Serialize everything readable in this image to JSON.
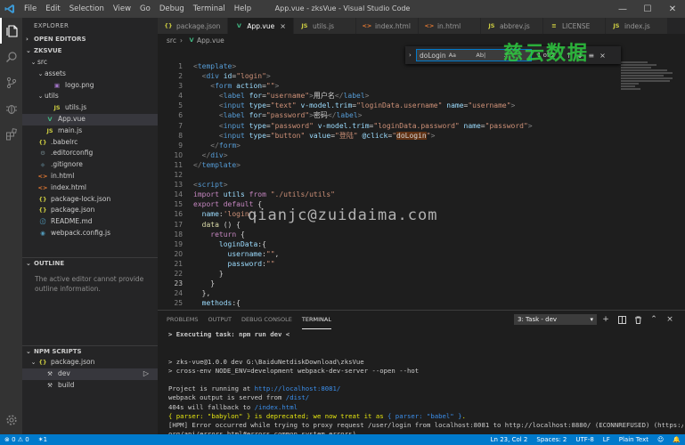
{
  "window": {
    "title": "App.vue - zksVue - Visual Studio Code",
    "menu": [
      "File",
      "Edit",
      "Selection",
      "View",
      "Go",
      "Debug",
      "Terminal",
      "Help"
    ]
  },
  "sidebar": {
    "title": "EXPLORER",
    "open_editors": "OPEN EDITORS",
    "project": "ZKSVUE",
    "tree": [
      {
        "label": "src",
        "indent": 1,
        "chev": "⌄",
        "icon": "",
        "color": ""
      },
      {
        "label": "assets",
        "indent": 2,
        "chev": "⌄",
        "icon": "",
        "color": ""
      },
      {
        "label": "logo.png",
        "indent": 3,
        "chev": "",
        "icon": "▣",
        "color": "#a074c4"
      },
      {
        "label": "utils",
        "indent": 2,
        "chev": "⌄",
        "icon": "",
        "color": ""
      },
      {
        "label": "utils.js",
        "indent": 3,
        "chev": "",
        "icon": "JS",
        "color": "#cbcb41"
      },
      {
        "label": "App.vue",
        "indent": 2,
        "chev": "",
        "icon": "V",
        "color": "#41b883",
        "selected": true
      },
      {
        "label": "main.js",
        "indent": 2,
        "chev": "",
        "icon": "JS",
        "color": "#cbcb41"
      },
      {
        "label": ".babelrc",
        "indent": 1,
        "chev": "",
        "icon": "{}",
        "color": "#cbcb41"
      },
      {
        "label": ".editorconfig",
        "indent": 1,
        "chev": "",
        "icon": "⚙",
        "color": "#6d8086"
      },
      {
        "label": ".gitignore",
        "indent": 1,
        "chev": "",
        "icon": "◆",
        "color": "#41535b"
      },
      {
        "label": "in.html",
        "indent": 1,
        "chev": "",
        "icon": "<>",
        "color": "#e37933"
      },
      {
        "label": "index.html",
        "indent": 1,
        "chev": "",
        "icon": "<>",
        "color": "#e37933"
      },
      {
        "label": "package-lock.json",
        "indent": 1,
        "chev": "",
        "icon": "{}",
        "color": "#cbcb41"
      },
      {
        "label": "package.json",
        "indent": 1,
        "chev": "",
        "icon": "{}",
        "color": "#cbcb41"
      },
      {
        "label": "README.md",
        "indent": 1,
        "chev": "",
        "icon": "ⓘ",
        "color": "#519aba"
      },
      {
        "label": "webpack.config.js",
        "indent": 1,
        "chev": "",
        "icon": "◉",
        "color": "#519aba"
      }
    ],
    "outline_title": "OUTLINE",
    "outline_msg": "The active editor cannot provide outline information.",
    "npm_title": "NPM SCRIPTS",
    "npm_tree": [
      {
        "label": "package.json",
        "indent": 1,
        "chev": "⌄",
        "icon": "{}",
        "color": "#cbcb41"
      },
      {
        "label": "dev",
        "indent": 2,
        "chev": "",
        "icon": "⚒",
        "color": "#cccccc",
        "selected": true,
        "run": "▷"
      },
      {
        "label": "build",
        "indent": 2,
        "chev": "",
        "icon": "⚒",
        "color": "#cccccc"
      }
    ]
  },
  "tabs": [
    {
      "label": "package.json",
      "icon": "{}",
      "color": "#cbcb41"
    },
    {
      "label": "App.vue",
      "icon": "V",
      "color": "#41b883",
      "active": true,
      "close": "×"
    },
    {
      "label": "utils.js",
      "icon": "JS",
      "color": "#cbcb41"
    },
    {
      "label": "index.html",
      "icon": "<>",
      "color": "#e37933"
    },
    {
      "label": "in.html",
      "icon": "<>",
      "color": "#e37933"
    },
    {
      "label": "abbrev.js",
      "icon": "JS",
      "color": "#cbcb41"
    },
    {
      "label": "LICENSE",
      "icon": "≡",
      "color": "#cbcb41"
    },
    {
      "label": "index.js",
      "icon": "JS",
      "color": "#cbcb41"
    }
  ],
  "breadcrumb": {
    "folder": "src",
    "file": "App.vue"
  },
  "find": {
    "query": "doLogin",
    "count": "1 of 2",
    "aa": "Aa",
    "ab": "Ab|",
    "re": ".*"
  },
  "editor": {
    "current_line": 23,
    "lines": [
      [
        [
          "t",
          "<"
        ],
        [
          "k",
          "template"
        ],
        [
          "t",
          ">"
        ]
      ],
      [
        [
          "",
          "  "
        ],
        [
          "t",
          "<"
        ],
        [
          "k",
          "div"
        ],
        [
          "",
          ""
        ],
        [
          "a",
          " id"
        ],
        [
          "",
          "="
        ],
        [
          "s",
          "\"login\""
        ],
        [
          "t",
          ">"
        ]
      ],
      [
        [
          "",
          "    "
        ],
        [
          "t",
          "<"
        ],
        [
          "k",
          "form"
        ],
        [
          "a",
          " action"
        ],
        [
          "",
          "="
        ],
        [
          "s",
          "\"\""
        ],
        [
          "t",
          ">"
        ]
      ],
      [
        [
          "",
          "      "
        ],
        [
          "t",
          "<"
        ],
        [
          "k",
          "label"
        ],
        [
          "a",
          " for"
        ],
        [
          "",
          "="
        ],
        [
          "s",
          "\"username\""
        ],
        [
          "t",
          ">"
        ],
        [
          "",
          "用户名"
        ],
        [
          "t",
          "</"
        ],
        [
          "k",
          "label"
        ],
        [
          "t",
          ">"
        ]
      ],
      [
        [
          "",
          "      "
        ],
        [
          "t",
          "<"
        ],
        [
          "k",
          "input"
        ],
        [
          "a",
          " type"
        ],
        [
          "",
          "="
        ],
        [
          "s",
          "\"text\""
        ],
        [
          "a",
          " v-model.trim"
        ],
        [
          "",
          "="
        ],
        [
          "s",
          "\"loginData.username\""
        ],
        [
          "a",
          " name"
        ],
        [
          "",
          "="
        ],
        [
          "s",
          "\"username\""
        ],
        [
          "t",
          ">"
        ]
      ],
      [
        [
          "",
          "      "
        ],
        [
          "t",
          "<"
        ],
        [
          "k",
          "label"
        ],
        [
          "a",
          " for"
        ],
        [
          "",
          "="
        ],
        [
          "s",
          "\"password\""
        ],
        [
          "t",
          ">"
        ],
        [
          "",
          "密码"
        ],
        [
          "t",
          "</"
        ],
        [
          "k",
          "label"
        ],
        [
          "t",
          ">"
        ]
      ],
      [
        [
          "",
          "      "
        ],
        [
          "t",
          "<"
        ],
        [
          "k",
          "input"
        ],
        [
          "a",
          " type"
        ],
        [
          "",
          "="
        ],
        [
          "s",
          "\"password\""
        ],
        [
          "a",
          " v-model.trim"
        ],
        [
          "",
          "="
        ],
        [
          "s",
          "\"loginData.password\""
        ],
        [
          "a",
          " name"
        ],
        [
          "",
          "="
        ],
        [
          "s",
          "\"password\""
        ],
        [
          "t",
          ">"
        ]
      ],
      [
        [
          "",
          "      "
        ],
        [
          "t",
          "<"
        ],
        [
          "k",
          "input"
        ],
        [
          "a",
          " type"
        ],
        [
          "",
          "="
        ],
        [
          "s",
          "\"button\""
        ],
        [
          "a",
          " value"
        ],
        [
          "",
          "="
        ],
        [
          "s",
          "\"登陆\""
        ],
        [
          "a",
          " @click"
        ],
        [
          "",
          "="
        ],
        [
          "s",
          "\""
        ],
        [
          "hl",
          "doLogin"
        ],
        [
          "s",
          "\""
        ],
        [
          "t",
          ">"
        ]
      ],
      [
        [
          "",
          "    "
        ],
        [
          "t",
          "</"
        ],
        [
          "k",
          "form"
        ],
        [
          "t",
          ">"
        ]
      ],
      [
        [
          "",
          "  "
        ],
        [
          "t",
          "</"
        ],
        [
          "k",
          "div"
        ],
        [
          "t",
          ">"
        ]
      ],
      [
        [
          "t",
          "</"
        ],
        [
          "k",
          "template"
        ],
        [
          "t",
          ">"
        ]
      ],
      [],
      [
        [
          "t",
          "<"
        ],
        [
          "k",
          "script"
        ],
        [
          "t",
          ">"
        ]
      ],
      [
        [
          "kc",
          "import"
        ],
        [
          "a",
          " utils"
        ],
        [
          "kc",
          " from"
        ],
        [
          "s",
          " \"./utils/utils\""
        ]
      ],
      [
        [
          "kc",
          "export"
        ],
        [
          "kc",
          " default"
        ],
        [
          "",
          " {"
        ]
      ],
      [
        [
          "",
          "  "
        ],
        [
          "a",
          "name"
        ],
        [
          "",
          ":"
        ],
        [
          "s",
          "'login'"
        ],
        [
          "",
          ","
        ]
      ],
      [
        [
          "",
          "  "
        ],
        [
          "fn",
          "data"
        ],
        [
          "",
          " () {"
        ]
      ],
      [
        [
          "",
          "    "
        ],
        [
          "kc",
          "return"
        ],
        [
          "",
          " {"
        ]
      ],
      [
        [
          "",
          "      "
        ],
        [
          "a",
          "loginData"
        ],
        [
          "",
          ":{"
        ]
      ],
      [
        [
          "",
          "        "
        ],
        [
          "a",
          "username"
        ],
        [
          "",
          ":"
        ],
        [
          "s",
          "\"\""
        ],
        [
          "",
          ","
        ]
      ],
      [
        [
          "",
          "        "
        ],
        [
          "a",
          "password"
        ],
        [
          "",
          ":"
        ],
        [
          "s",
          "\"\""
        ]
      ],
      [
        [
          "",
          "      }"
        ]
      ],
      [
        [
          "",
          "    }"
        ]
      ],
      [
        [
          "",
          "  },"
        ]
      ],
      [
        [
          "",
          "  "
        ],
        [
          "a",
          "methods"
        ],
        [
          "",
          ":{"
        ]
      ]
    ]
  },
  "watermark": {
    "logo": "慈云数据",
    "email": "qianjc@zuidaima.com"
  },
  "panel": {
    "tabs": [
      "PROBLEMS",
      "OUTPUT",
      "DEBUG CONSOLE",
      "TERMINAL"
    ],
    "active_tab": 3,
    "terminal_select": "3: Task - dev",
    "icons": [
      "+",
      "◫",
      "🗑",
      "⌃",
      "×"
    ],
    "lines": [
      [
        [
          "b",
          "> Executing task: npm run dev <"
        ]
      ],
      [],
      [],
      [
        [
          "",
          "> zks-vue@1.0.0 dev G:\\BaiduNetdiskDownload\\zksVue"
        ]
      ],
      [
        [
          "",
          "> cross-env NODE_ENV=development webpack-dev-server --open --hot"
        ]
      ],
      [],
      [
        [
          "",
          "Project is running at "
        ],
        [
          "url",
          "http://localhost:8081/"
        ]
      ],
      [
        [
          "",
          "webpack output is served from "
        ],
        [
          "url",
          "/dist/"
        ]
      ],
      [
        [
          "",
          "404s will fallback to "
        ],
        [
          "url",
          "/index.html"
        ]
      ],
      [
        [
          "y",
          "{ parser: \"babylon\" } is deprecated; we now treat it as "
        ],
        [
          "url",
          "{ parser: \"babel\" }"
        ],
        [
          "y",
          "."
        ]
      ],
      [
        [
          "",
          "[HPM] Error occurred while trying to proxy request /user/login from localhost:8081 to http://localhost:8880/ (ECONNREFUSED) (https://nodejs."
        ]
      ],
      [
        [
          "",
          "org/api/errors.html#errors_common_system_errors)"
        ]
      ]
    ]
  },
  "status": {
    "errors": "⊗ 0",
    "warnings": "⚠ 0",
    "tasks": "✶1",
    "position": "Ln 23, Col 2",
    "spaces": "Spaces: 2",
    "encoding": "UTF-8",
    "eol": "LF",
    "language": "Plain Text"
  }
}
